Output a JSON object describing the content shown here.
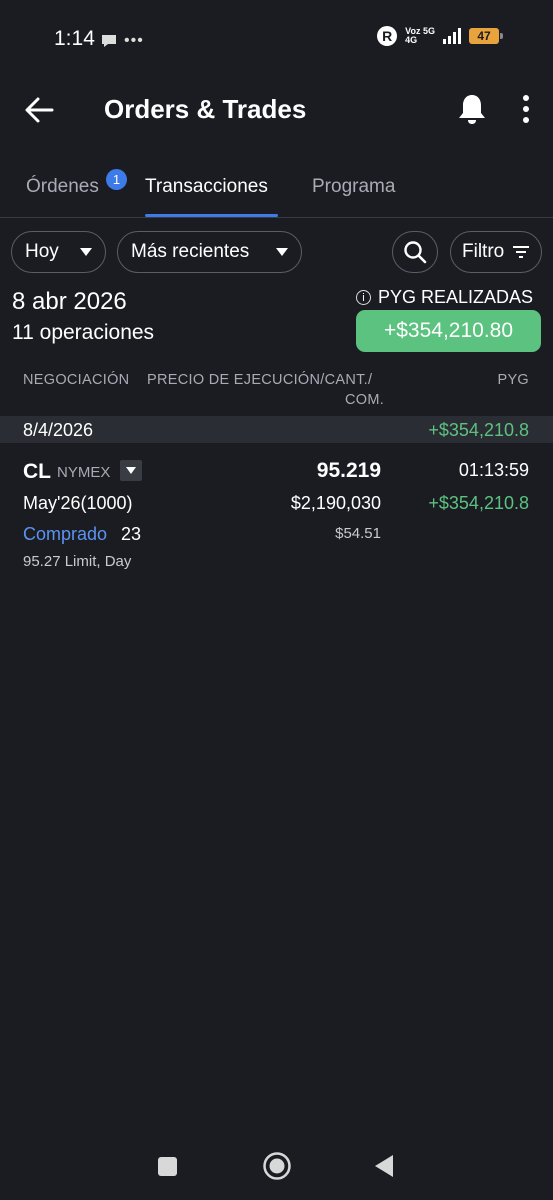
{
  "status_bar": {
    "time": "1:14",
    "left_icons": "•••",
    "badge": "R",
    "network_top": "Voz 5G",
    "network_bottom": "4G",
    "battery": "47"
  },
  "header": {
    "title": "Orders & Trades"
  },
  "tabs": [
    {
      "label": "Órdenes",
      "badge": "1",
      "active": false
    },
    {
      "label": "Transacciones",
      "active": true
    },
    {
      "label": "Programa",
      "active": false
    }
  ],
  "filters": {
    "period": "Hoy",
    "sort": "Más recientes",
    "filter_label": "Filtro"
  },
  "summary": {
    "date": "8 abr 2026",
    "count": "11 operaciones",
    "realized_label": "PYG REALIZADAS",
    "realized_value": "+$354,210.80"
  },
  "columns": {
    "trade": "NEGOCIACIÓN",
    "exec_line1": "PRECIO DE EJECUCIÓN/CANT./",
    "exec_line2": "COM.",
    "pnl": "PYG"
  },
  "groups": [
    {
      "date": "8/4/2026",
      "pnl": "+$354,210.8",
      "trades": [
        {
          "symbol": "CL",
          "exchange": "NYMEX",
          "price": "95.219",
          "time": "01:13:59",
          "contract": "May'26(1000)",
          "notional": "$2,190,030",
          "pnl": "+$354,210.8",
          "side": "Comprado",
          "quantity": "23",
          "commission": "$54.51",
          "order": "95.27 Limit, Day"
        }
      ]
    }
  ],
  "colors": {
    "background": "#1b1c22",
    "accent": "#3d7be8",
    "positive": "#5cc280",
    "buy": "#5b93f0"
  }
}
